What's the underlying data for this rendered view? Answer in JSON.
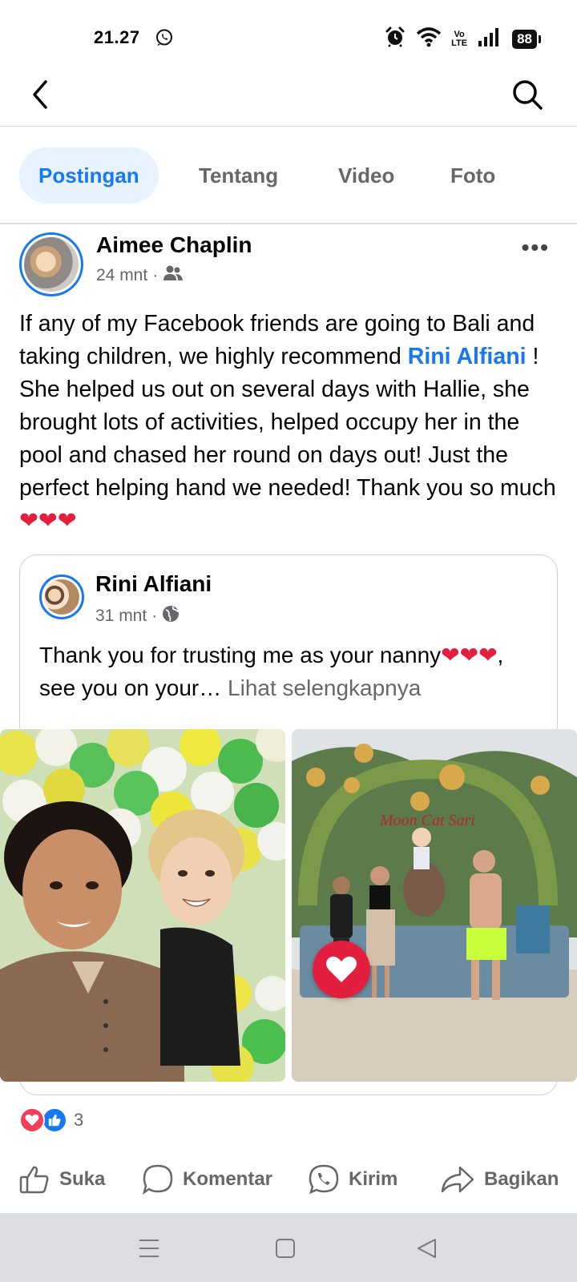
{
  "status_bar": {
    "time": "21.27",
    "network_label": "Vo\nLTE",
    "battery": "88",
    "icons": [
      "whatsapp-icon",
      "alarm-icon",
      "wifi-icon",
      "signal-icon",
      "battery-icon"
    ]
  },
  "nav": {
    "back_icon": "chevron-left-icon",
    "search_icon": "search-icon"
  },
  "tabs": [
    {
      "label": "Postingan",
      "active": true
    },
    {
      "label": "Tentang",
      "active": false
    },
    {
      "label": "Video",
      "active": false
    },
    {
      "label": "Foto",
      "active": false
    }
  ],
  "post": {
    "author": "Aimee Chaplin",
    "time": "24 mnt",
    "separator": "·",
    "audience_icon": "friends-icon",
    "text_before": "If any of my Facebook friends are going to Bali and taking children, we highly recommend ",
    "mention": "Rini Alfiani",
    "text_after": " ! She helped us out on several days with Hallie, she brought lots of activities, helped occupy her in the pool and chased her round on days out! Just the perfect helping hand we needed! Thank you so much ",
    "hearts": "❤❤❤"
  },
  "shared_post": {
    "author": "Rini Alfiani",
    "time": "31 mnt",
    "separator": "·",
    "audience_icon": "globe-icon",
    "text_before": "Thank you for trusting me as your nanny",
    "hearts_1": "❤",
    "hearts_2": "❤❤",
    "text_after": ", see you on your… ",
    "see_more": "Lihat selengkapnya"
  },
  "reactions": {
    "icons": [
      "love-reaction-icon",
      "like-reaction-icon"
    ],
    "count": "3"
  },
  "actions": [
    {
      "label": "Suka",
      "icon": "thumbs-up-icon"
    },
    {
      "label": "Komentar",
      "icon": "comment-icon"
    },
    {
      "label": "Kirim",
      "icon": "messenger-icon"
    },
    {
      "label": "Bagikan",
      "icon": "share-icon"
    }
  ],
  "colors": {
    "accent": "#1877f2",
    "accent_bg": "#e7f3ff",
    "love": "#e41e3f",
    "secondary_text": "#65676b"
  }
}
